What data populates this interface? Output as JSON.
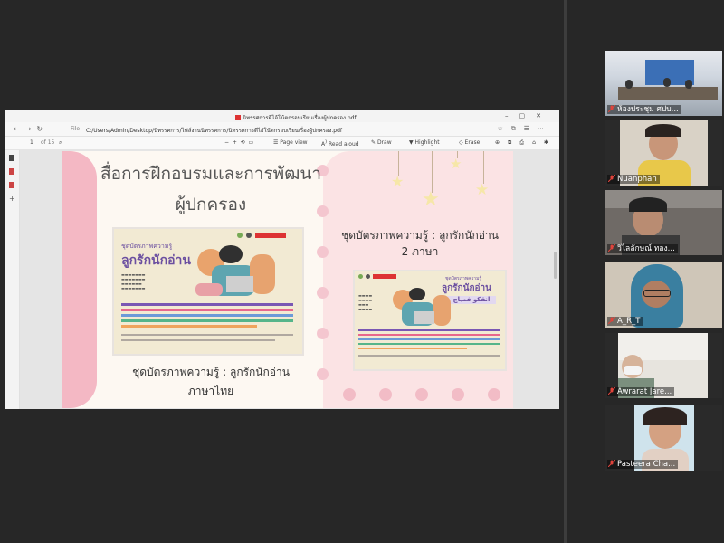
{
  "pdf_viewer": {
    "tab_title": "นิทรรศการดีไอ้โน้ตกรอบเรียนเรื่องผู้ปกครอง.pdf",
    "file_tag": "File",
    "file_path": "C:/Users/Admin/Desktop/นิทรรศการ/ไฟล์งานนิทรรศการ/นิทรรศการดีไอ้โน้ตกรอบเรียนเรื่องผู้ปกครอง.pdf",
    "page_current": "1",
    "page_total": "of 15",
    "toolbar": {
      "page_view": "Page view",
      "read_aloud": "Read aloud",
      "draw": "Draw",
      "highlight": "Highlight",
      "erase": "Erase"
    }
  },
  "slide": {
    "heading_line1": "สื่อการฝึกอบรมและการพัฒนา",
    "heading_line2": "ผู้ปกครอง",
    "card1": {
      "title_small": "ชุดบัตรภาพความรู้",
      "title_big": "ลูกรักนักอ่าน",
      "caption_line1": "ชุดบัตรภาพความรู้ : ลูกรักนักอ่าน",
      "caption_line2": "ภาษาไทย"
    },
    "card2": {
      "title_small": "ชุดบัตรภาพความรู้",
      "title_big": "ลูกรักนักอ่าน",
      "caption_line1": "ชุดบัตรภาพความรู้ : ลูกรักนักอ่าน",
      "caption_line2": "2 ภาษา"
    }
  },
  "participants": [
    {
      "name": "ห้องประชุม ศปบ..."
    },
    {
      "name": "Nuanphan"
    },
    {
      "name": "วิไลลักษณ์ ทอง..."
    },
    {
      "name": "A_R_T"
    },
    {
      "name": "Awrarat Jare..."
    },
    {
      "name": "Pasteera Cha..."
    }
  ],
  "colors": {
    "background": "#272727",
    "pink_accent": "#f4b8c4",
    "title_purple": "#6b4fa0",
    "mic_muted": "#e0443c"
  }
}
